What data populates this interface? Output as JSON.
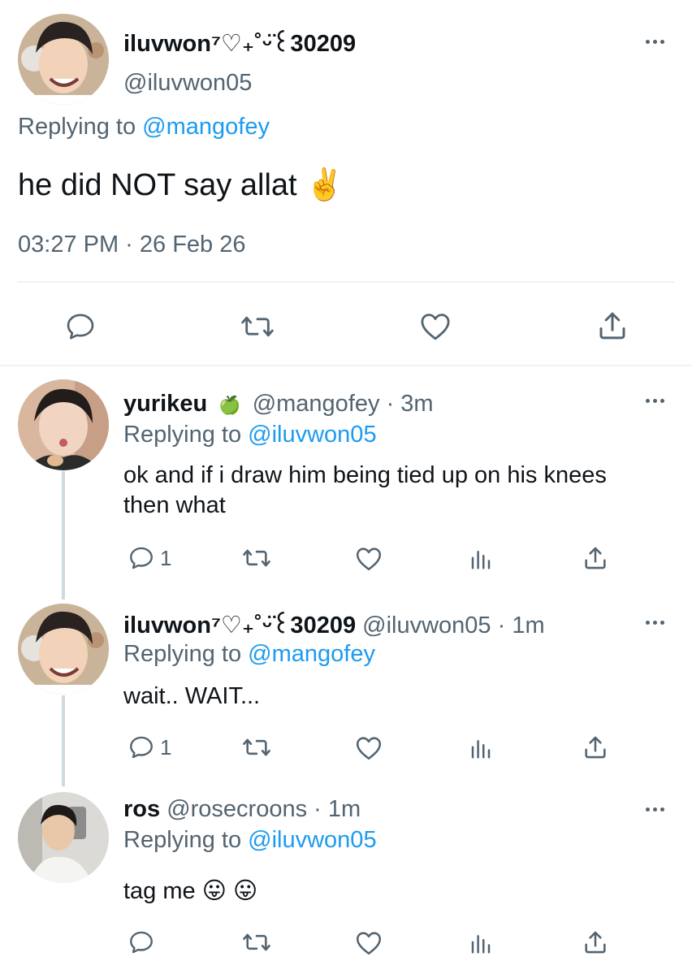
{
  "main_tweet": {
    "display_name": "iluvwon⁷♡₊˚ᵕ̈꒰30209",
    "handle": "@iluvwon05",
    "replying_prefix": "Replying to",
    "replying_to": "@mangofey",
    "text": "he did NOT say allat ✌️",
    "timestamp": "03:27 PM · 26 Feb 26",
    "actions": [
      "reply-icon",
      "retweet-icon",
      "like-icon",
      "share-icon"
    ]
  },
  "replies": [
    {
      "display_name": "yurikeu",
      "badge_emoji": "🍏",
      "handle": "@mangofey",
      "separator": "·",
      "time": "3m",
      "replying_prefix": "Replying to",
      "replying_to": "@iluvwon05",
      "text_line1": "ok and if i draw him being tied up on his knees",
      "text_line2": "then what",
      "reply_count": "1"
    },
    {
      "display_name": "iluvwon⁷♡₊˚ᵕ̈꒰30209",
      "handle": "@iluvwon05",
      "separator": "·",
      "time": "1m",
      "replying_prefix": "Replying to",
      "replying_to": "@mangofey",
      "text": "wait.. WAIT...",
      "reply_count": "1"
    },
    {
      "display_name": "ros",
      "handle": "@rosecroons",
      "separator": "·",
      "time": "1m",
      "replying_prefix": "Replying to",
      "replying_to": "@iluvwon05",
      "text": "tag me 😛 😛",
      "reply_count": ""
    }
  ],
  "colors": {
    "link": "#1d9bf0",
    "muted": "#536471",
    "text": "#0f1419",
    "divider": "#eff3f4",
    "thread_line": "#cfd9de"
  }
}
